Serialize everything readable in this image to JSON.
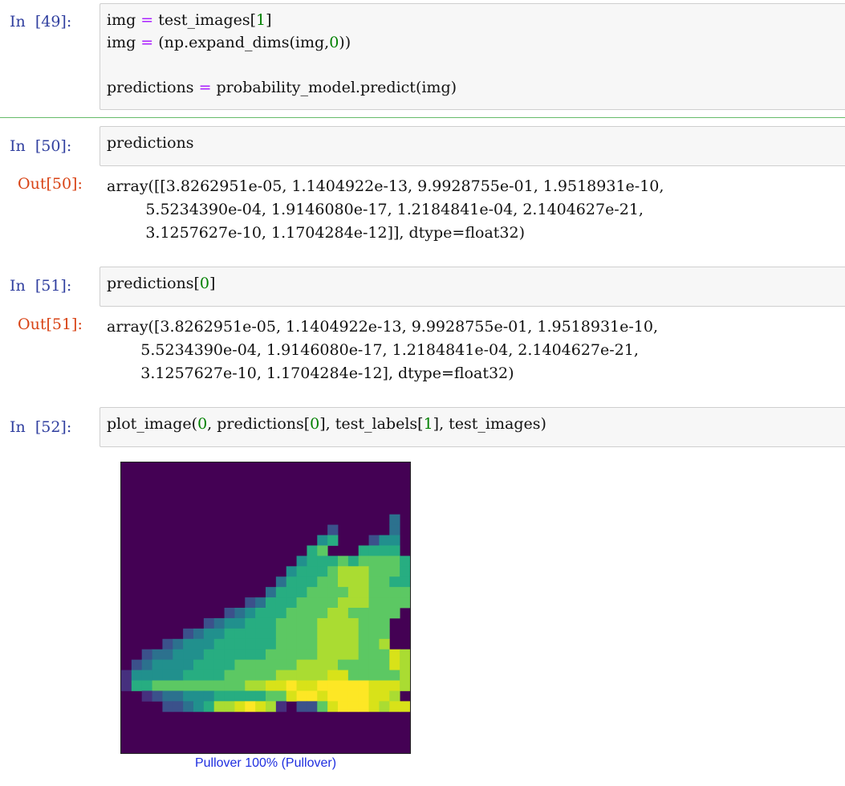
{
  "cells": {
    "c49": {
      "prompt": "In  [49]:",
      "lines": [
        [
          [
            "img ",
            ""
          ],
          [
            "=",
            "op"
          ],
          [
            " test_images[",
            ""
          ],
          [
            "1",
            "num"
          ],
          [
            "]",
            ""
          ]
        ],
        [
          [
            "img ",
            ""
          ],
          [
            "=",
            "op"
          ],
          [
            " (np.expand_dims(img,",
            ""
          ],
          [
            "0",
            "num"
          ],
          [
            "))",
            ""
          ]
        ],
        [
          [
            "",
            ""
          ]
        ],
        [
          [
            "predictions ",
            ""
          ],
          [
            "=",
            "op"
          ],
          [
            " probability_model.predict(img)",
            ""
          ]
        ]
      ]
    },
    "c50": {
      "prompt": "In  [50]:",
      "code": "predictions",
      "out_prompt": "Out[50]:",
      "output": "array([[3.8262951e-05, 1.1404922e-13, 9.9928755e-01, 1.9518931e-10,\n        5.5234390e-04, 1.9146080e-17, 1.2184841e-04, 2.1404627e-21,\n        3.1257627e-10, 1.1704284e-12]], dtype=float32)"
    },
    "c51": {
      "prompt": "In  [51]:",
      "code_pre": "predictions[",
      "code_num": "0",
      "code_post": "]",
      "out_prompt": "Out[51]:",
      "output": "array([3.8262951e-05, 1.1404922e-13, 9.9928755e-01, 1.9518931e-10,\n       5.5234390e-04, 1.9146080e-17, 1.2184841e-04, 2.1404627e-21,\n       3.1257627e-10, 1.1704284e-12], dtype=float32)"
    },
    "c52": {
      "prompt": "In  [52]:",
      "code_parts": [
        [
          "plot_image(",
          ""
        ],
        [
          "0",
          "num"
        ],
        [
          ", predictions[",
          ""
        ],
        [
          "0",
          "num"
        ],
        [
          "], test_labels[",
          ""
        ],
        [
          "1",
          "num"
        ],
        [
          "], test_images)",
          ""
        ]
      ],
      "plot_caption": "Pullover 100% (Pullover)"
    }
  },
  "colors": {
    "in_prompt": "#303f9f",
    "out_prompt": "#d84315",
    "caption": "#1f2fe0",
    "viridis_bg": "#440154"
  },
  "image": {
    "grid": 28,
    "pixels": [
      "............................",
      "............................",
      "............................",
      "............................",
      "............................",
      "..........................3.",
      "....................2.....3.",
      "...................45...244.",
      "..................56...5555.",
      ".................45556566665",
      "................455567776665",
      "...............3555667776655",
      "..............355566667766665",
      "............2355566667776666.",
      "..........23455566667766666.",
      "........234455566667777666..",
      "......23445555566667777666..",
      "....2344455555566667777667..",
      "..23344455555566666777766687",
      ".234444555566666677776666687",
      "1444445555666667777788666667",
      "1556666666667788988999998887",
      "..1233444555556689989999887.",
      "....223457789871.22689998788",
      "............................",
      "............................",
      "............................",
      "............................"
    ]
  }
}
